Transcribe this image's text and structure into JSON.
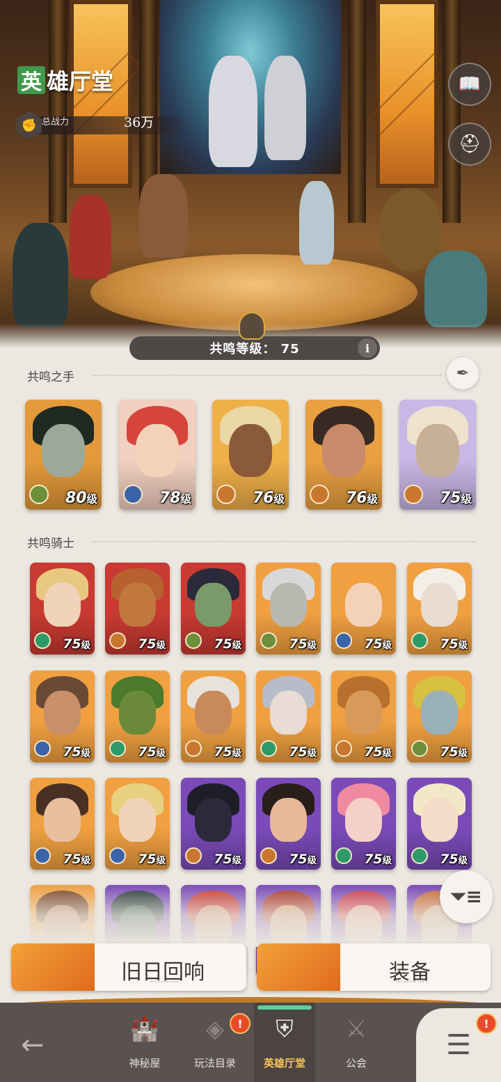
{
  "header": {
    "title_first": "英",
    "title_rest": "雄厅堂",
    "power_label": "总战力",
    "power_value": "36万"
  },
  "resonance": {
    "label": "共鸣等级：",
    "level": "75",
    "info": "i"
  },
  "sections": {
    "hands_title": "共鸣之手",
    "knights_title": "共鸣骑士"
  },
  "hands": [
    {
      "level": "80",
      "unit": "级",
      "cls_color": "#6b8f3a",
      "bg": "#e49a3a",
      "hair": "#1e2a22",
      "skin": "#9aa99a"
    },
    {
      "level": "78",
      "unit": "级",
      "cls_color": "#3b63a8",
      "bg": "#f2d0c0",
      "hair": "#d6453a",
      "skin": "#f4d2b8"
    },
    {
      "level": "76",
      "unit": "级",
      "cls_color": "#c9772e",
      "bg": "#f0b048",
      "hair": "#e9d7a6",
      "skin": "#8a5a3a"
    },
    {
      "level": "76",
      "unit": "级",
      "cls_color": "#c9772e",
      "bg": "#eaa040",
      "hair": "#3a2a24",
      "skin": "#c88a6a"
    },
    {
      "level": "75",
      "unit": "级",
      "cls_color": "#c9772e",
      "bg": "#c9b7e6",
      "hair": "#efe2cf",
      "skin": "#c8b098"
    }
  ],
  "knights": [
    {
      "level": "75",
      "unit": "级",
      "cls_color": "#2e9a6a",
      "bg": "#c83a32",
      "hair": "#e8c880",
      "skin": "#f0d2b8"
    },
    {
      "level": "75",
      "unit": "级",
      "cls_color": "#c9772e",
      "bg": "#c83a32",
      "hair": "#b8602e",
      "skin": "#c0783e"
    },
    {
      "level": "75",
      "unit": "级",
      "cls_color": "#6b8f3a",
      "bg": "#c83a32",
      "hair": "#2a2a3a",
      "skin": "#7a9a6a"
    },
    {
      "level": "75",
      "unit": "级",
      "cls_color": "#6b8f3a",
      "bg": "#f0a040",
      "hair": "#d8d8da",
      "skin": "#b8b8b0"
    },
    {
      "level": "75",
      "unit": "级",
      "cls_color": "#3b63a8",
      "bg": "#f0a040",
      "hair": "#f0a040",
      "skin": "#f4d2b8"
    },
    {
      "level": "75",
      "unit": "级",
      "cls_color": "#2e9a6a",
      "bg": "#f0a040",
      "hair": "#f2efe8",
      "skin": "#e8dcd0"
    },
    {
      "level": "75",
      "unit": "级",
      "cls_color": "#3b63a8",
      "bg": "#f0a040",
      "hair": "#6a4a34",
      "skin": "#c8906a"
    },
    {
      "level": "75",
      "unit": "级",
      "cls_color": "#2e9a6a",
      "bg": "#f0a040",
      "hair": "#4a7a2a",
      "skin": "#6a8a3a"
    },
    {
      "level": "75",
      "unit": "级",
      "cls_color": "#c9772e",
      "bg": "#f0a040",
      "hair": "#e8e2dc",
      "skin": "#c88a5a"
    },
    {
      "level": "75",
      "unit": "级",
      "cls_color": "#2e9a6a",
      "bg": "#f0a040",
      "hair": "#b8bcc8",
      "skin": "#e8dcd4"
    },
    {
      "level": "75",
      "unit": "级",
      "cls_color": "#c9772e",
      "bg": "#f0a040",
      "hair": "#b8702e",
      "skin": "#d89a5a"
    },
    {
      "level": "75",
      "unit": "级",
      "cls_color": "#6b8f3a",
      "bg": "#f0a040",
      "hair": "#d8c040",
      "skin": "#9ab0b8"
    },
    {
      "level": "75",
      "unit": "级",
      "cls_color": "#3b63a8",
      "bg": "#f0a040",
      "hair": "#4a3024",
      "skin": "#e8c0a0"
    },
    {
      "level": "75",
      "unit": "级",
      "cls_color": "#3b63a8",
      "bg": "#f0a040",
      "hair": "#e8d080",
      "skin": "#f0d2b8"
    },
    {
      "level": "75",
      "unit": "级",
      "cls_color": "#c9772e",
      "bg": "#7a4ab8",
      "hair": "#1e1e2a",
      "skin": "#2a2a3a"
    },
    {
      "level": "75",
      "unit": "级",
      "cls_color": "#c9772e",
      "bg": "#7a4ab8",
      "hair": "#2a1e1a",
      "skin": "#e8b898"
    },
    {
      "level": "75",
      "unit": "级",
      "cls_color": "#2e9a6a",
      "bg": "#7a4ab8",
      "hair": "#f08aa0",
      "skin": "#f4d0c8"
    },
    {
      "level": "75",
      "unit": "级",
      "cls_color": "#2e9a6a",
      "bg": "#7a4ab8",
      "hair": "#f2e8c8",
      "skin": "#f4dcc8"
    },
    {
      "level": "",
      "unit": "",
      "cls_color": "#f0a040",
      "bg": "#f0a040",
      "hair": "#7a4a2a",
      "skin": "#c89070"
    },
    {
      "level": "",
      "unit": "",
      "cls_color": "#7a4ab8",
      "bg": "#7a4ab8",
      "hair": "#2a3a3a",
      "skin": "#4a6a5a"
    },
    {
      "level": "",
      "unit": "",
      "cls_color": "#7a4ab8",
      "bg": "#7a4ab8",
      "hair": "#c83a32",
      "skin": "#d89a7a"
    },
    {
      "level": "",
      "unit": "",
      "cls_color": "#7a4ab8",
      "bg": "#7a4ab8",
      "hair": "#a83a2a",
      "skin": "#d8a07a"
    },
    {
      "level": "",
      "unit": "",
      "cls_color": "#7a4ab8",
      "bg": "#7a4ab8",
      "hair": "#c83a4a",
      "skin": "#e8b0a0"
    },
    {
      "level": "",
      "unit": "",
      "cls_color": "#7a4ab8",
      "bg": "#7a4ab8",
      "hair": "#c86a3a",
      "skin": "#d8b090"
    }
  ],
  "actions": {
    "echo_label": "旧日回响",
    "equip_label": "装备"
  },
  "nav": {
    "mystery_label": "神秘屋",
    "catalog_label": "玩法目录",
    "hall_label": "英雄厅堂",
    "guild_label": "公会",
    "badge_text": "!"
  },
  "icons": {
    "back": "arrow-left-icon",
    "menu": "list-menu-icon",
    "filter": "filter-icon",
    "book": "book-icon",
    "helmets": "helmets-icon",
    "feather": "feather-icon"
  },
  "colors": {
    "accent_orange": "#e8892a",
    "active_nav_text": "#f6c35a",
    "badge_red": "#e94a2a",
    "title_green": "#3f9a4a"
  }
}
